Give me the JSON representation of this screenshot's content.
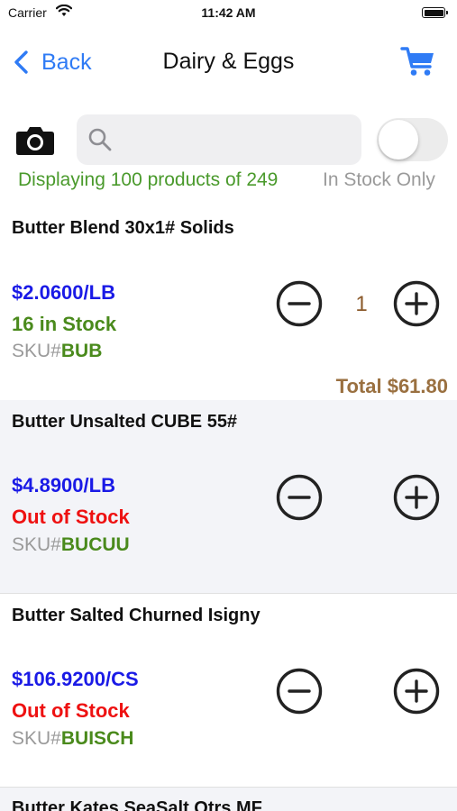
{
  "status_bar": {
    "carrier": "Carrier",
    "time": "11:42 AM"
  },
  "nav": {
    "back_label": "Back",
    "title": "Dairy & Eggs"
  },
  "search": {
    "value": "",
    "placeholder": ""
  },
  "filter": {
    "display_count": "Displaying 100 products of 249",
    "in_stock_label": "In Stock Only",
    "in_stock_only_enabled": false
  },
  "products": [
    {
      "name": "Butter Blend 30x1# Solids",
      "price": "$2.0600/LB",
      "stock": "16 in Stock",
      "sku_prefix": "SKU#",
      "sku": "BUB",
      "quantity": "1",
      "total": "Total $61.80"
    },
    {
      "name": "Butter Unsalted CUBE 55#",
      "price": "$4.8900/LB",
      "stock": "Out of Stock",
      "sku_prefix": "SKU#",
      "sku": "BUCUU"
    },
    {
      "name": "Butter Salted Churned Isigny",
      "price": "$106.9200/CS",
      "stock": "Out of Stock",
      "sku_prefix": "SKU#",
      "sku": "BUISCH"
    },
    {
      "name": "Butter Kates SeaSalt Qtrs MF"
    }
  ],
  "colors": {
    "accent_blue": "#2f7bf5",
    "price_blue": "#1a1ae6",
    "in_stock_green": "#4a8a1c",
    "out_of_stock_red": "#ee1111",
    "total_brown": "#9a7040"
  },
  "icons": {
    "back": "chevron-left-icon",
    "cart": "cart-icon",
    "camera": "camera-icon",
    "search": "search-icon",
    "decrement": "minus-circle-icon",
    "increment": "plus-circle-icon"
  }
}
